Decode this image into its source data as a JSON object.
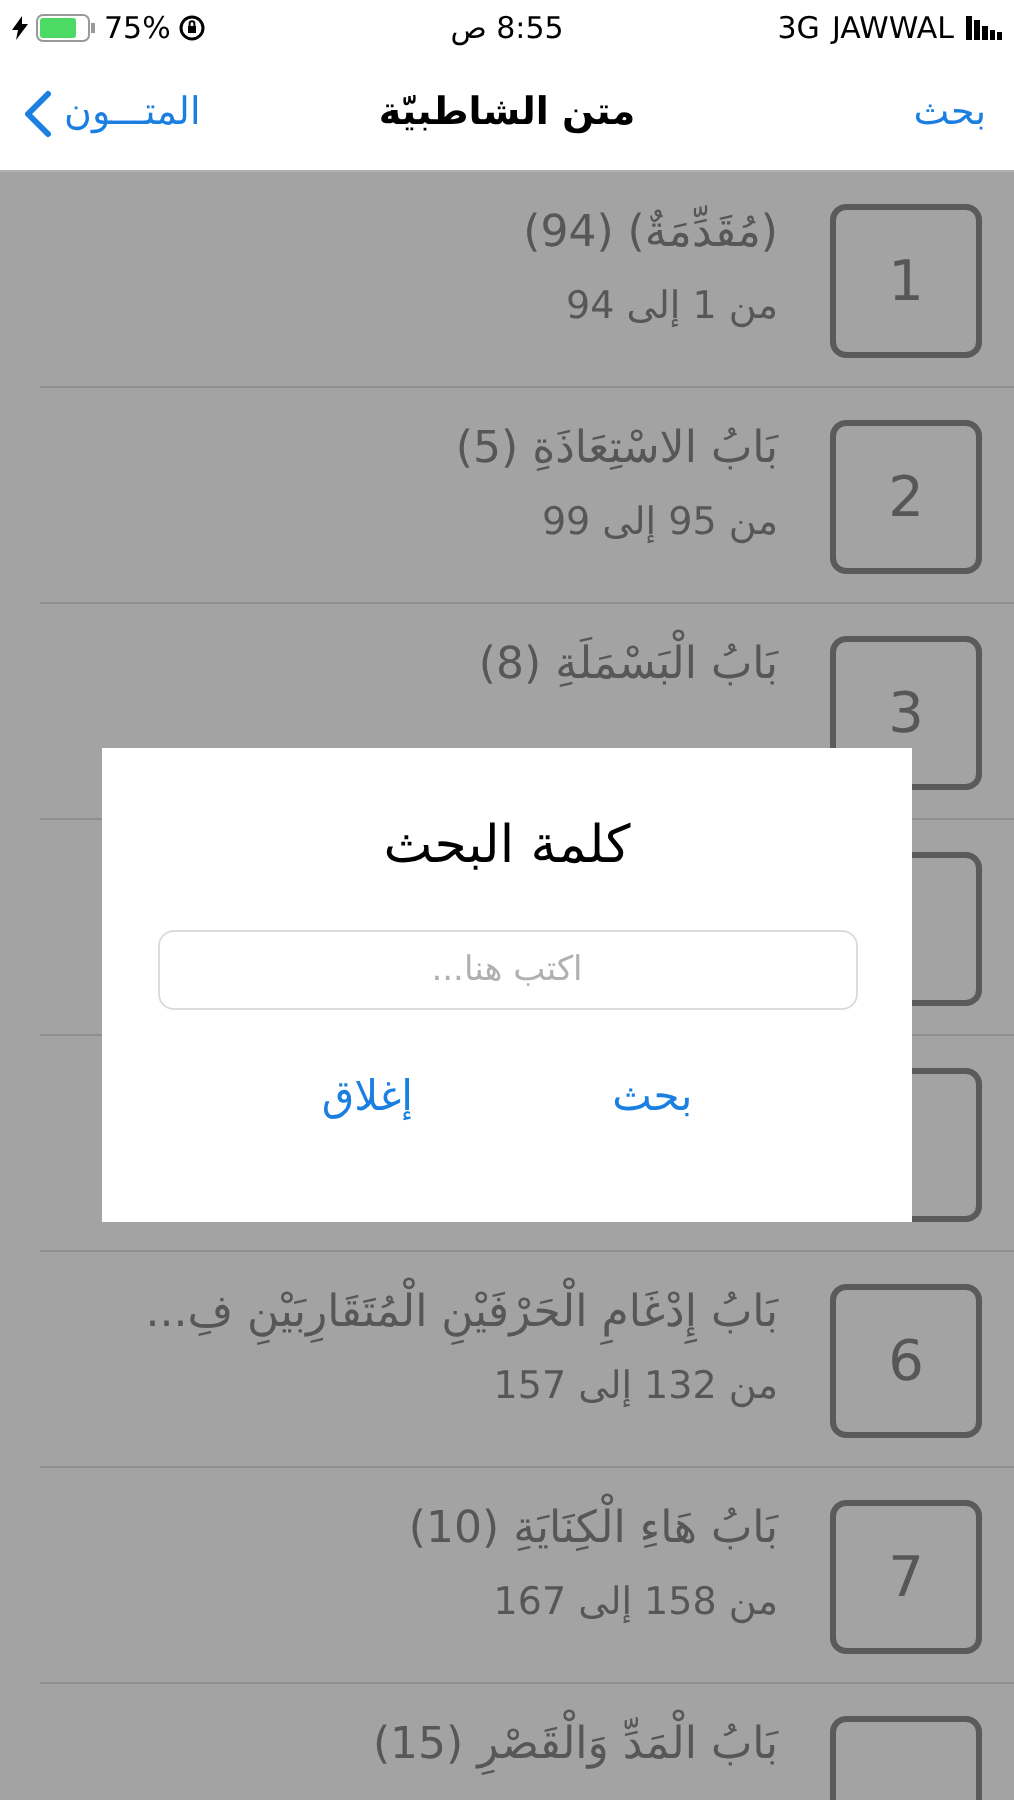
{
  "status_bar": {
    "battery": "75%",
    "time": "8:55 ص",
    "network": "3G",
    "carrier": "JAWWAL"
  },
  "nav_bar": {
    "back": "المتـــون",
    "title": "متن الشاطبيّة",
    "action": "بحث"
  },
  "rows": [
    {
      "number": "1",
      "title": "(مُقَدِّمَةٌ) (94)",
      "range": "من 1 إلى 94"
    },
    {
      "number": "2",
      "title": "بَابُ الاسْتِعَاذَةِ (5)",
      "range": "من 95 إلى 99"
    },
    {
      "number": "3",
      "title": "بَابُ الْبَسْمَلَةِ (8)"
    },
    {},
    {},
    {
      "number": "6",
      "title": "بَابُ إِدْغَامِ الْحَرْفَيْنِ الْمُتَقَارِبَيْنِ فِ...",
      "range": "من 132 إلى 157"
    },
    {
      "number": "7",
      "title": "بَابُ هَاءِ الْكِنَايَةِ (10)",
      "range": "من 158 إلى 167"
    },
    {
      "title": "بَابُ الْمَدِّ وَالْقَصْرِ (15)"
    }
  ],
  "dialog": {
    "title": "كلمة البحث",
    "placeholder": "اكتب هنا...",
    "buttons": [
      "بحث",
      "إغلاق"
    ]
  }
}
